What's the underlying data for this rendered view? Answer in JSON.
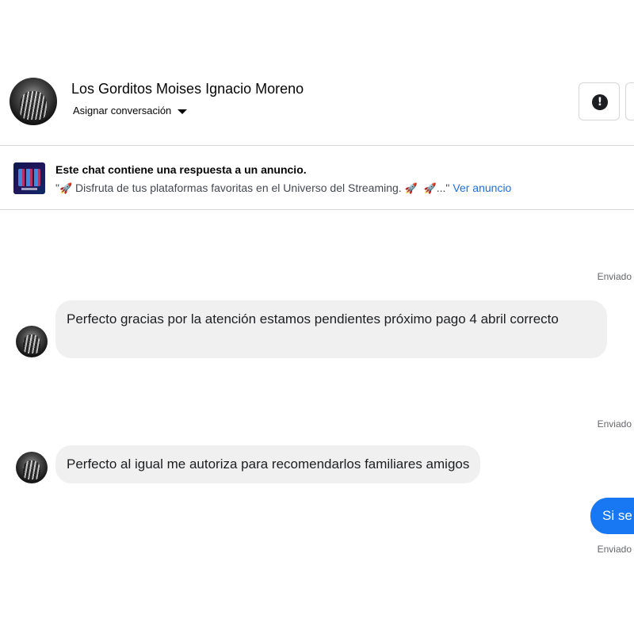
{
  "header": {
    "contact_name": "Los Gorditos Moises Ignacio Moreno",
    "assign_label": "Asignar conversación",
    "info_icon": "exclamation-circle-icon"
  },
  "ad_banner": {
    "title": "Este chat contiene una respuesta a un anuncio.",
    "quote_open": "\"",
    "rocket": "🚀",
    "text": " Disfruta de tus plataformas favoritas en el Universo del Streaming. ",
    "ellipsis": "...\"",
    "link_label": "Ver anuncio"
  },
  "messages": [
    {
      "status": "Enviado",
      "text": "Perfecto gracias por la atención estamos pendientes próximo pago  4 abril correcto"
    },
    {
      "status": "Enviado",
      "text": "Perfecto al igual me autoriza para recomendarlos familiares amigos"
    }
  ],
  "outgoing": {
    "text": "Si se",
    "status": "Enviado"
  },
  "colors": {
    "accent": "#1877f2",
    "link": "#216fdb",
    "bubble_in": "#f0f0f0"
  }
}
